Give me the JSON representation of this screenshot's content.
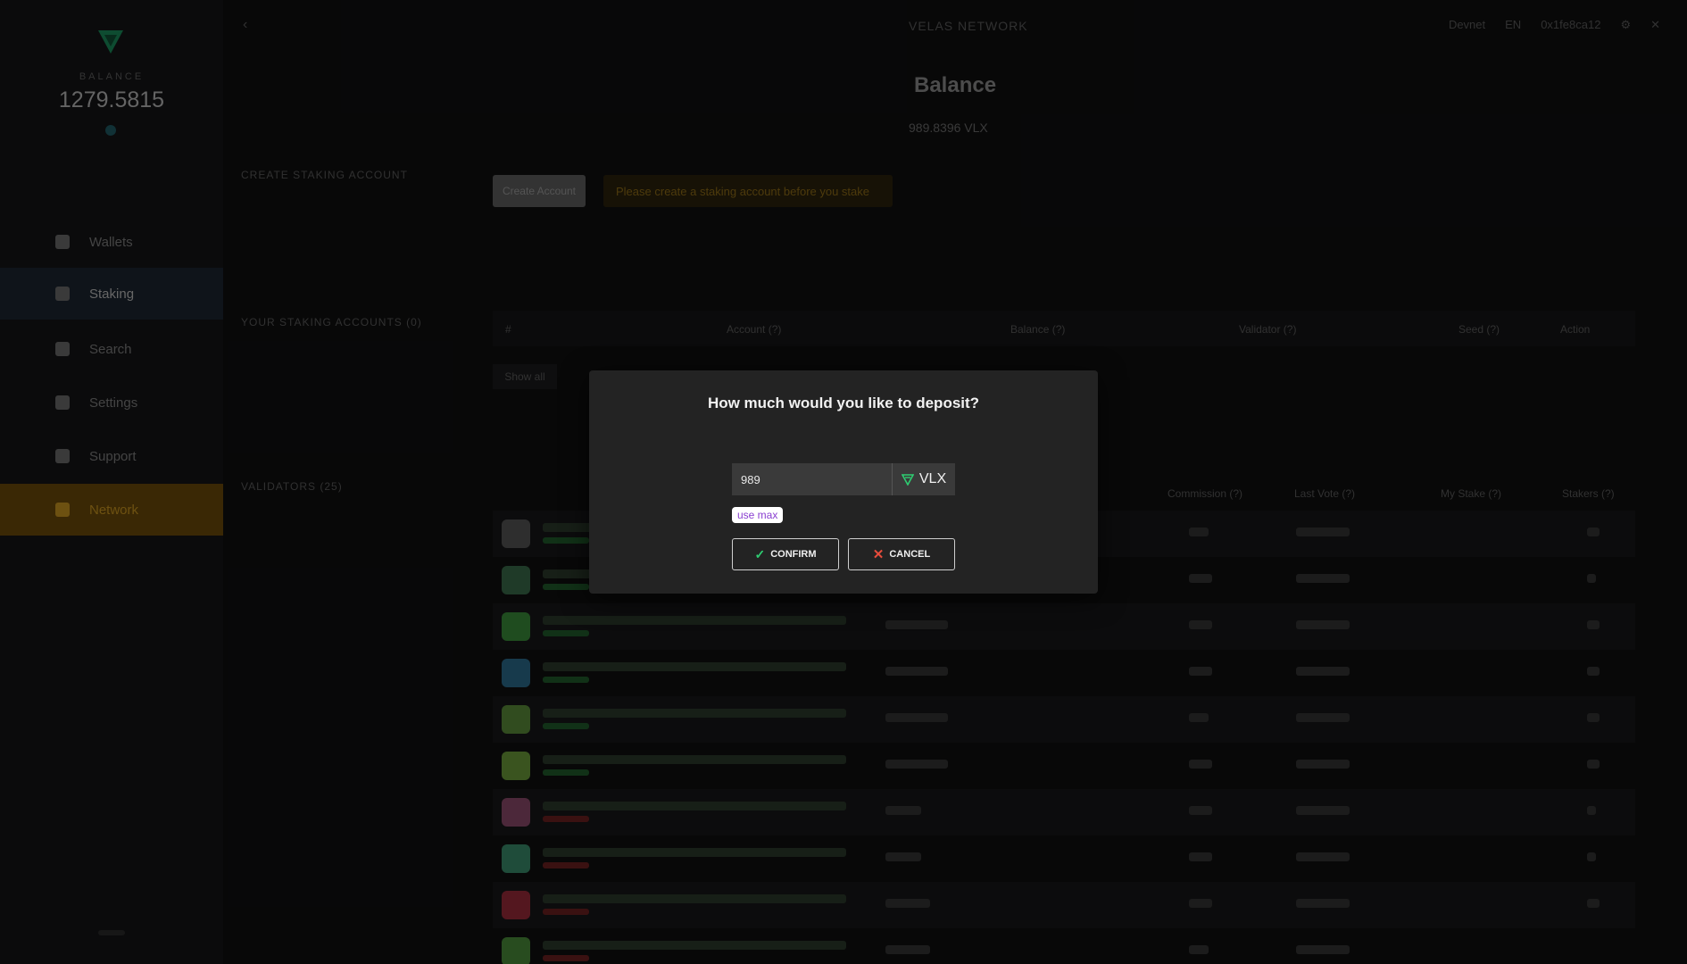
{
  "sidebar": {
    "balance_label": "BALANCE",
    "balance_value": "1279.5815",
    "nav": [
      {
        "label": "Wallets"
      },
      {
        "label": "Staking"
      },
      {
        "label": "Search"
      },
      {
        "label": "Settings"
      },
      {
        "label": "Support"
      },
      {
        "label": "Network"
      }
    ]
  },
  "header": {
    "network": "VELAS NETWORK",
    "right_items": [
      "Devnet",
      "EN",
      "0x1fe8ca12",
      "⚙",
      "✕"
    ]
  },
  "page": {
    "title": "Balance",
    "subtitle": "989.8396 VLX",
    "staking_section": "CREATE STAKING ACCOUNT",
    "stake_button": "Create Account",
    "notice": "Please create a staking account before you stake",
    "accounts_section": "YOUR STAKING ACCOUNTS (0)",
    "validators_section": "VALIDATORS (25)",
    "show_all": "Show all",
    "accounts_columns": [
      "#",
      "Account (?)",
      "Balance (?)",
      "Validator (?)",
      "Seed (?)",
      "Action"
    ],
    "validators_columns": [
      "Commission (?)",
      "Last Vote (?)",
      "My Stake (?)",
      "Stakers (?)"
    ]
  },
  "modal": {
    "title": "How much would you like to deposit?",
    "amount_value": "989",
    "token": "VLX",
    "use_max": "use max",
    "confirm": "CONFIRM",
    "cancel": "CANCEL"
  },
  "colors": {
    "accent_green": "#2ecc71",
    "accent_red": "#e74c3c",
    "use_max_text": "#8a3fd1",
    "warning": "#c79420"
  }
}
